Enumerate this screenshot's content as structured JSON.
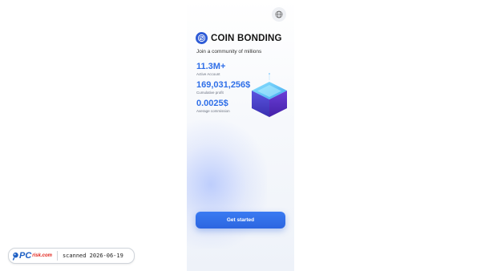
{
  "header": {
    "language_icon": "globe-icon"
  },
  "brand": {
    "name": "COIN BONDING",
    "logo_icon": "coin-bonding-logo-icon"
  },
  "tagline": "Join a community of millions",
  "stats": [
    {
      "value": "11.3M+",
      "label": "Active Account"
    },
    {
      "value": "169,031,256$",
      "label": "Cumulative profit"
    },
    {
      "value": "0.0025$",
      "label": "Average commission"
    }
  ],
  "cta": {
    "label": "Get started"
  },
  "badge": {
    "logo_pc": "PC",
    "logo_risk": "risk.com",
    "scanned_text": "scanned 2026-06-19"
  },
  "colors": {
    "accent": "#2f6fe8",
    "button": "#2c65e0",
    "cube_top": "#6fd0ff",
    "cube_side": "#5a3fd1"
  }
}
